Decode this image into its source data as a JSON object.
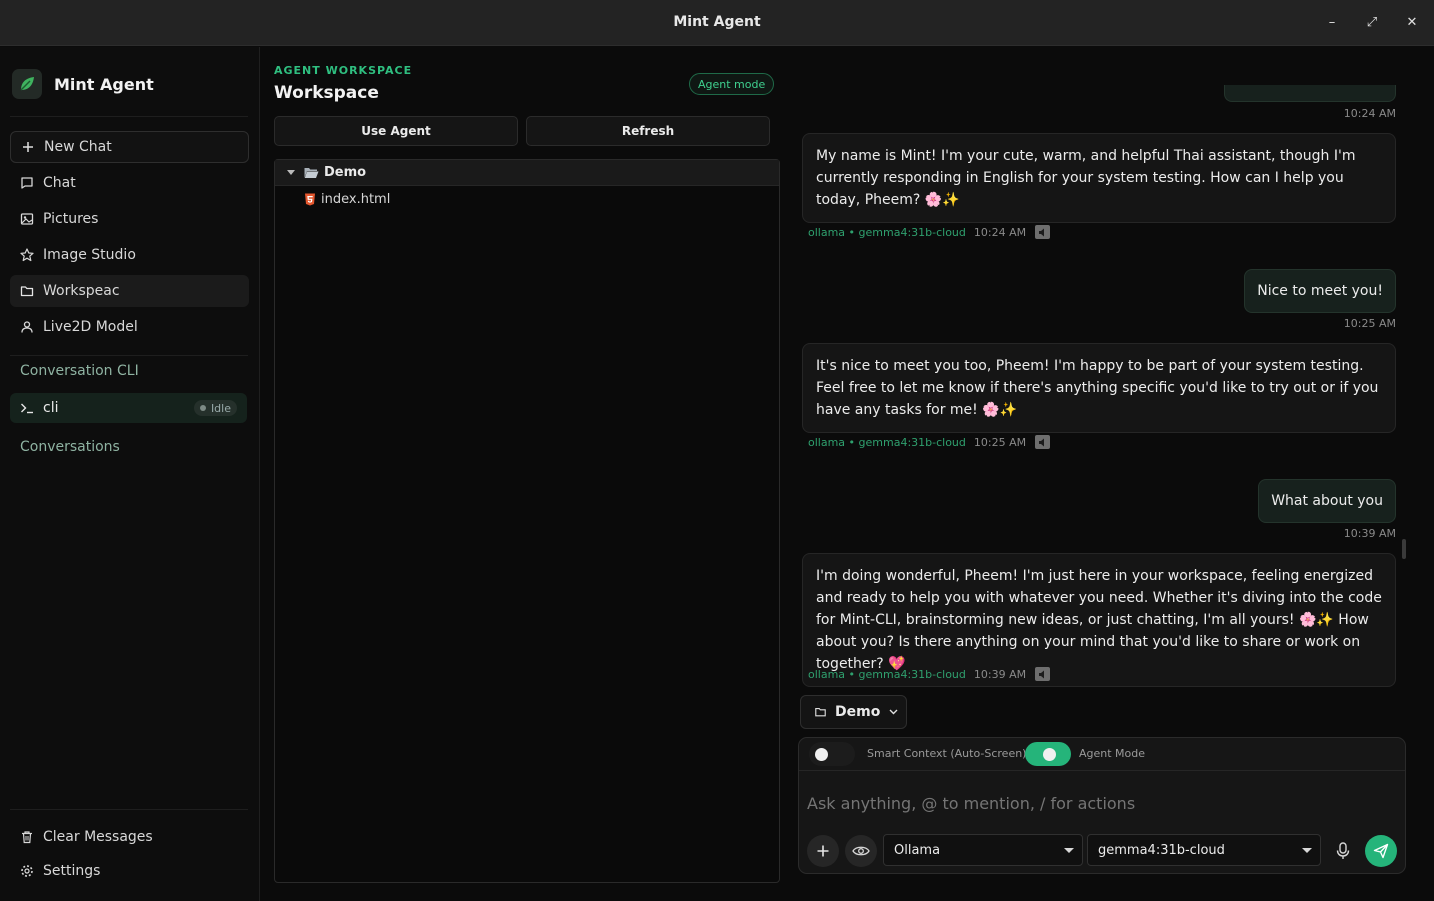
{
  "window": {
    "title": "Mint Agent",
    "minimize": "–",
    "maximize": "⤢",
    "close": "✕"
  },
  "sidebar": {
    "brand": "Mint Agent",
    "new_chat": "New Chat",
    "items": [
      {
        "label": "Chat",
        "icon": "chat-icon"
      },
      {
        "label": "Pictures",
        "icon": "image-icon"
      },
      {
        "label": "Image Studio",
        "icon": "star-icon"
      },
      {
        "label": "Workspeac",
        "icon": "folder-icon"
      },
      {
        "label": "Live2D Model",
        "icon": "user-icon"
      }
    ],
    "cli_section": "Conversation CLI",
    "cli_item": {
      "label": "cli",
      "status": "Idle"
    },
    "conversations_section": "Conversations",
    "clear_messages": "Clear Messages",
    "settings": "Settings"
  },
  "workspace": {
    "eyebrow": "AGENT WORKSPACE",
    "title": "Workspace",
    "agent_mode_pill": "Agent mode",
    "use_agent": "Use Agent",
    "refresh": "Refresh",
    "tree": {
      "folder": "Demo",
      "files": [
        "index.html"
      ]
    }
  },
  "chat": {
    "top_timestamp": "10:24 AM",
    "messages": [
      {
        "role": "assistant",
        "text": "My name is Mint! I'm your cute, warm, and helpful Thai assistant, though I'm currently responding in English for your system testing. How can I help you today, Pheem? 🌸✨",
        "model": "ollama • gemma4:31b-cloud",
        "time": "10:24 AM"
      },
      {
        "role": "user",
        "text": "Nice to meet you!",
        "time": "10:25 AM"
      },
      {
        "role": "assistant",
        "text": "It's nice to meet you too, Pheem! I'm happy to be part of your system testing. Feel free to let me know if there's anything specific you'd like to try out or if you have any tasks for me! 🌸✨",
        "model": "ollama • gemma4:31b-cloud",
        "time": "10:25 AM"
      },
      {
        "role": "user",
        "text": "What about you",
        "time": "10:39 AM"
      },
      {
        "role": "assistant",
        "text": "I'm doing wonderful, Pheem! I'm just here in your workspace, feeling energized and ready to help you with whatever you need. Whether it's diving into the code for Mint-CLI, brainstorming new ideas, or just chatting, I'm all yours! 🌸✨ How about you? Is there anything on your mind that you'd like to share or work on together? 💖",
        "model": "ollama • gemma4:31b-cloud",
        "time": "10:39 AM"
      }
    ],
    "folder_button": "Demo",
    "smart_context_label": "Smart Context (Auto-Screen)",
    "smart_context_on": false,
    "agent_mode_label": "Agent Mode",
    "agent_mode_on": true,
    "input_placeholder": "Ask anything, @ to mention, / for actions",
    "provider": "Ollama",
    "model": "gemma4:31b-cloud"
  },
  "colors": {
    "accent": "#25b47a",
    "accent_text": "#2fbf80",
    "background": "#0b0b0b"
  }
}
